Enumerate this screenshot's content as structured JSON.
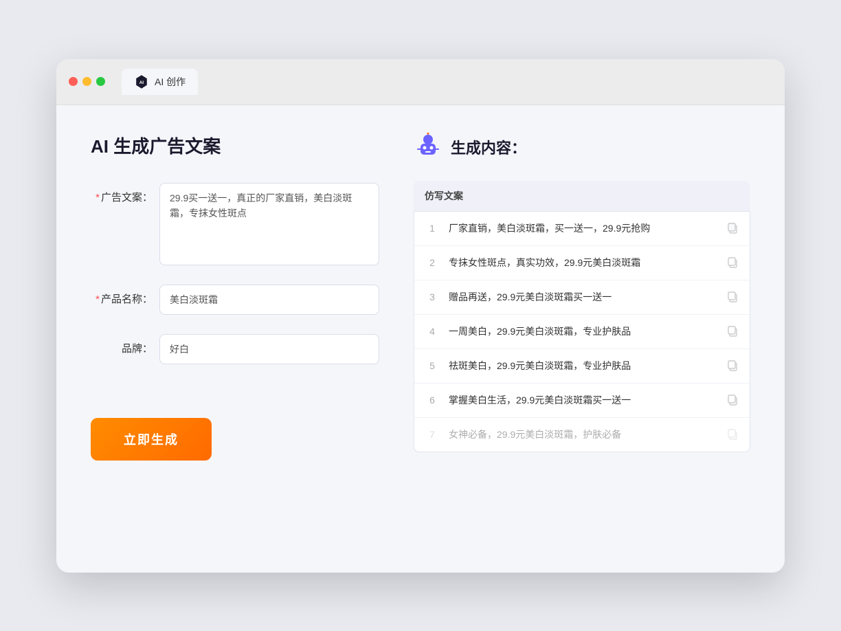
{
  "browser": {
    "tab_label": "AI 创作"
  },
  "left": {
    "page_title": "AI 生成广告文案",
    "fields": [
      {
        "label": "广告文案：",
        "required": true,
        "type": "textarea",
        "value": "29.9买一送一，真正的厂家直销，美白淡斑霜，专抹女性斑点",
        "name": "ad-copy-input"
      },
      {
        "label": "产品名称：",
        "required": true,
        "type": "input",
        "value": "美白淡斑霜",
        "name": "product-name-input"
      },
      {
        "label": "品牌：",
        "required": false,
        "type": "input",
        "value": "好白",
        "name": "brand-input"
      }
    ],
    "button_label": "立即生成"
  },
  "right": {
    "section_title": "生成内容：",
    "table_header": "仿写文案",
    "items": [
      {
        "num": "1",
        "text": "厂家直销，美白淡斑霜，买一送一，29.9元抢购",
        "faded": false
      },
      {
        "num": "2",
        "text": "专抹女性斑点，真实功效，29.9元美白淡斑霜",
        "faded": false
      },
      {
        "num": "3",
        "text": "赠品再送，29.9元美白淡斑霜买一送一",
        "faded": false
      },
      {
        "num": "4",
        "text": "一周美白，29.9元美白淡斑霜，专业护肤品",
        "faded": false
      },
      {
        "num": "5",
        "text": "祛斑美白，29.9元美白淡斑霜，专业护肤品",
        "faded": false
      },
      {
        "num": "6",
        "text": "掌握美白生活，29.9元美白淡斑霜买一送一",
        "faded": false
      },
      {
        "num": "7",
        "text": "女神必备，29.9元美白淡斑霜，护肤必备",
        "faded": true
      }
    ]
  }
}
